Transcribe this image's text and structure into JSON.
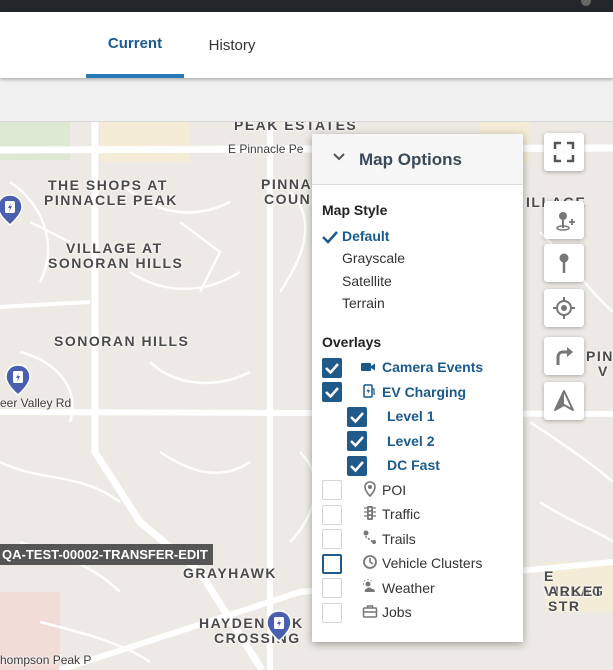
{
  "tabs": {
    "current": "Current",
    "history": "History"
  },
  "map": {
    "places": {
      "peak_estates": "PEAK ESTATES",
      "shops_line1": "THE SHOPS AT",
      "shops_line2": "PINNACLE PEAK",
      "pinnacle_line1": "PINNA",
      "pinnacle_line2": "COUN",
      "village_line1": "VILLAGE AT",
      "village_line2": "SONORAN HILLS",
      "sonoran_hills": "SONORAN HILLS",
      "grayhawk": "GRAYHAWK",
      "hayden_line1": "HAYDEN",
      "hayden_partial": "K",
      "hayden_line2": "CROSSING",
      "illage_right": "ILLAGE",
      "pin_right": "PIN",
      "v_right": "V",
      "village_right_line1": "E VILLAG",
      "village_right_line2": "ARKET STR"
    },
    "streets": {
      "pinnacle_peak": "E Pinnacle Pe",
      "deer_valley": "eer Valley Rd",
      "thompson_peak": "hompson Peak P"
    },
    "vehicle_label": "QA-TEST-00002-TRANSFER-EDIT"
  },
  "map_options": {
    "title": "Map Options",
    "map_style_heading": "Map Style",
    "styles": [
      "Default",
      "Grayscale",
      "Satellite",
      "Terrain"
    ],
    "selected_style": "Default",
    "overlays_heading": "Overlays",
    "overlays": [
      {
        "label": "Camera Events",
        "checked": true,
        "icon": "camera-icon"
      },
      {
        "label": "EV Charging",
        "checked": true,
        "icon": "ev-charging-icon"
      },
      {
        "label": "Level 1",
        "checked": true,
        "icon": ""
      },
      {
        "label": "Level 2",
        "checked": true,
        "icon": ""
      },
      {
        "label": "DC Fast",
        "checked": true,
        "icon": ""
      },
      {
        "label": "POI",
        "checked": false,
        "icon": "map-pin-icon"
      },
      {
        "label": "Traffic",
        "checked": false,
        "icon": "traffic-light-icon"
      },
      {
        "label": "Trails",
        "checked": false,
        "icon": "trails-icon"
      },
      {
        "label": "Vehicle Clusters",
        "checked": false,
        "icon": "vehicle-clusters-icon"
      },
      {
        "label": "Weather",
        "checked": false,
        "icon": "weather-icon"
      },
      {
        "label": "Jobs",
        "checked": false,
        "icon": "briefcase-icon"
      }
    ]
  },
  "colors": {
    "accent": "#1a5b8c",
    "checkbox": "#1f5a8a",
    "tab_underline": "#2a7ab8",
    "ev_pin": "#4a5fb0"
  }
}
